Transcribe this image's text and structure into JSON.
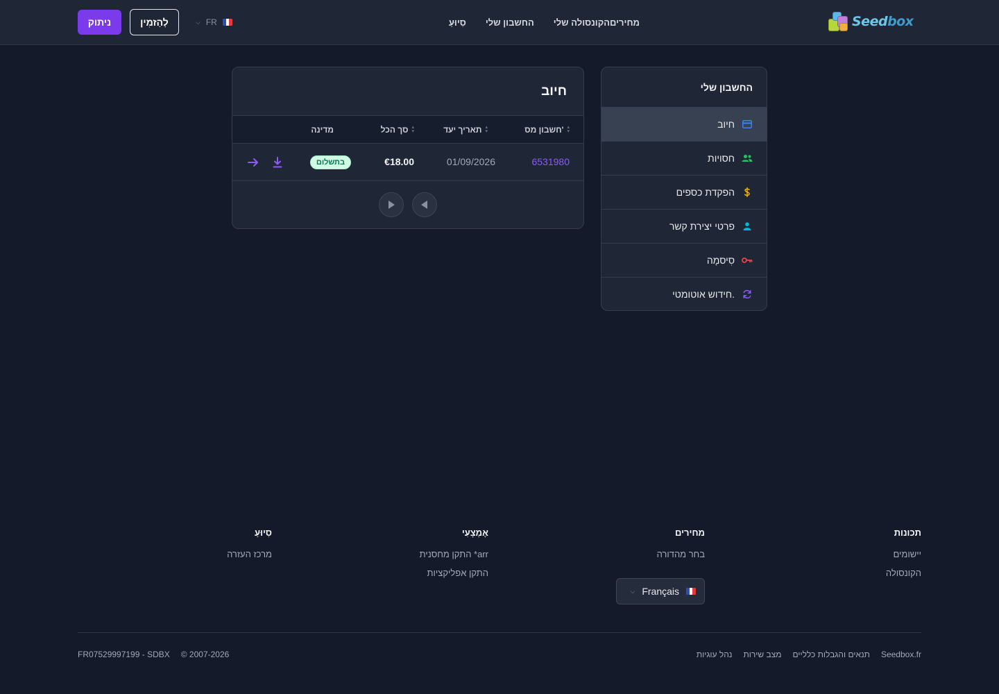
{
  "header": {
    "logo_text_1": "Seed",
    "logo_text_2": "box",
    "nav": [
      "מחירים",
      "הקונסולה שלי",
      "החשבון שלי",
      "סִיוּעַ"
    ],
    "lang_code": "FR",
    "order_button": "לְהַזמִין",
    "logout_button": "ניתוק"
  },
  "sidebar": {
    "title": "החשבון שלי",
    "items": [
      {
        "label": "חיוב",
        "icon": "credit-card-icon",
        "color": "#3b82f6",
        "active": true
      },
      {
        "label": "חסויות",
        "icon": "users-icon",
        "color": "#22c55e",
        "active": false
      },
      {
        "label": "הפקדת כספים",
        "icon": "dollar-icon",
        "color": "#eab308",
        "active": false
      },
      {
        "label": "פרטי יצירת קשר",
        "icon": "user-icon",
        "color": "#06b6d4",
        "active": false
      },
      {
        "label": "סִיסמָה",
        "icon": "key-icon",
        "color": "#ef4444",
        "active": false
      },
      {
        "label": "חידוש אוטומטי.",
        "icon": "refresh-icon",
        "color": "#8b5cf6",
        "active": false
      }
    ]
  },
  "billing": {
    "title": "חיוב",
    "columns": [
      "חשבון מס'",
      "תאריך יעד",
      "סך הכל",
      "מדינה"
    ],
    "rows": [
      {
        "invoice": "6531980",
        "due_date": "01/09/2026",
        "total": "€18.00",
        "status": "בתשלום"
      }
    ]
  },
  "footer": {
    "columns": [
      {
        "title": "תכונות",
        "links": [
          "יישומים",
          "הקונסולה"
        ]
      },
      {
        "title": "מחירים",
        "links": [
          "בחר מהדורה"
        ]
      },
      {
        "title": "אֶמְצָעִי",
        "links": [
          "התקן מחסנית *arr",
          "התקן אפליקציות"
        ]
      },
      {
        "title": "סִיוּעַ",
        "links": [
          "מרכז העזרה"
        ]
      }
    ],
    "language": "Français",
    "bottom_links": [
      "Seedbox.fr",
      "תנאים והגבלות כלליים",
      "מצב שירות",
      "נהל עוגיות"
    ],
    "copyright": "© 2007-2026",
    "company_id": "FR07529997199 - SDBX"
  },
  "colors": {
    "accent": "#7c3aed",
    "link": "#8b5cf6",
    "paid_bg": "#d1fae5",
    "paid_text": "#047857"
  }
}
